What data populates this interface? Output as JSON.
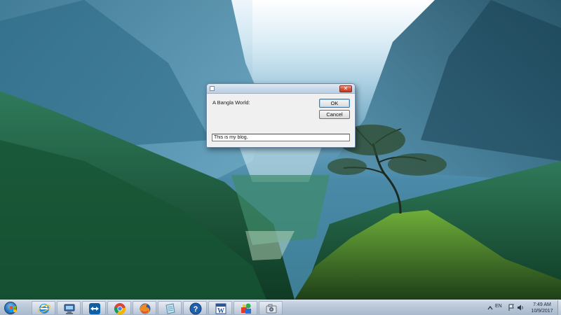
{
  "dialog": {
    "prompt": "A Bangla World:",
    "ok_label": "OK",
    "cancel_label": "Cancel",
    "input_value": "This is my blog.",
    "close_label": "✕"
  },
  "taskbar": {
    "apps": [
      {
        "name": "start-button",
        "icon": "windows-start-icon"
      },
      {
        "name": "internet-explorer",
        "icon": "internet-explorer-icon"
      },
      {
        "name": "network",
        "icon": "network-computer-icon"
      },
      {
        "name": "teamviewer",
        "icon": "teamviewer-icon"
      },
      {
        "name": "chrome",
        "icon": "chrome-icon"
      },
      {
        "name": "firefox",
        "icon": "firefox-icon"
      },
      {
        "name": "notes",
        "icon": "notepad-icon"
      },
      {
        "name": "help",
        "icon": "help-icon"
      },
      {
        "name": "word",
        "icon": "word-icon"
      },
      {
        "name": "paint",
        "icon": "paint-icon"
      },
      {
        "name": "camera",
        "icon": "camera-icon"
      }
    ],
    "language": "EN",
    "time": "7:49 AM",
    "date": "10/9/2017"
  },
  "colors": {
    "taskbar": "#b9c7d8",
    "dialog_bg": "#f0f0f0",
    "close_red": "#c23b22",
    "accent_blue": "#3c7fb1"
  }
}
